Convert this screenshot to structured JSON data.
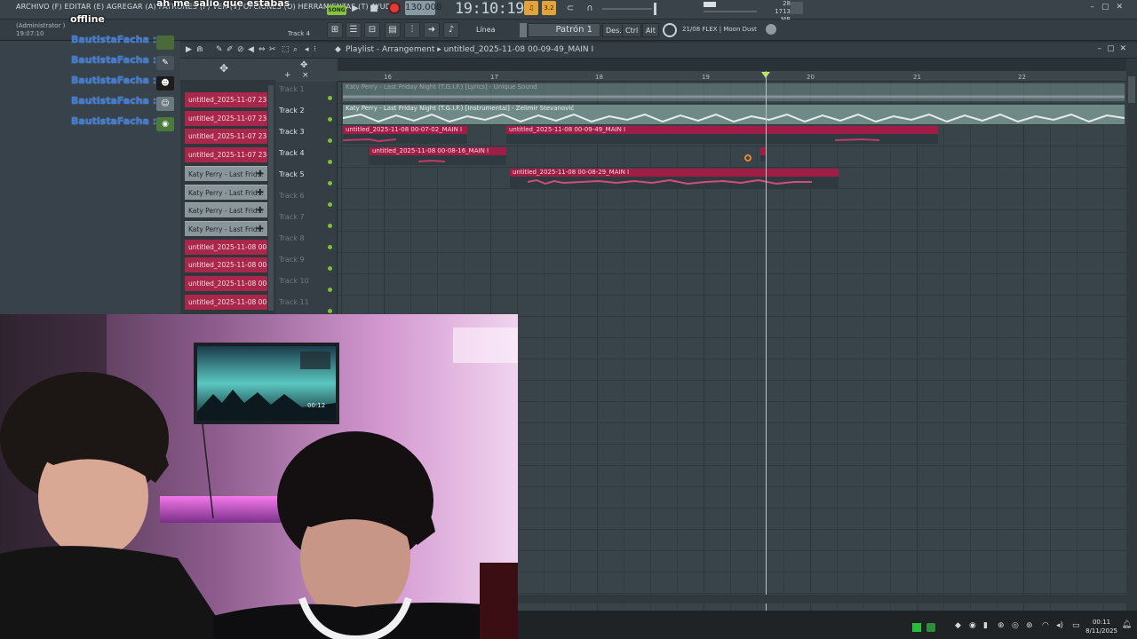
{
  "menu": {
    "text": "ARCHIVO (F) EDITAR (E) AGREGAR (A) PATRONES (P) VER (V) OPCIONES (O) HERRAMIENTAS (T) AYUDA"
  },
  "overlay_chat": {
    "line1": "ah me salio que estabas",
    "line2": "offline"
  },
  "transport": {
    "song_label": "SONG",
    "tempo": "130.000",
    "time": "19:10:19",
    "cpu_lines": [
      "28",
      "1713 MB",
      "0"
    ]
  },
  "toolbar2": {
    "admin_line1": "(Administrator )",
    "admin_line2": "19:07:10",
    "track_hint": "Track 4",
    "snap": "Línea",
    "pattern": "Patrón 1",
    "btn_des": "Des.",
    "btn_ctrl": "Ctrl",
    "btn_alt": "Alt",
    "flex_info": "21/08  FLEX | Moon Dust"
  },
  "chat": {
    "user": "BautistaFacha :",
    "messages": [
      "",
      "",
      "",
      "",
      ""
    ]
  },
  "playlist": {
    "title": "Playlist - Arrangement  ▸  untitled_2025-11-08 00-09-49_MAIN I"
  },
  "picker": {
    "items": [
      {
        "label": "untitled_2025-11-07 23-...",
        "type": "red"
      },
      {
        "label": "untitled_2025-11-07 23-...",
        "type": "red"
      },
      {
        "label": "untitled_2025-11-07 23-...",
        "type": "red"
      },
      {
        "label": "untitled_2025-11-07 23-...",
        "type": "red"
      },
      {
        "label": "Katy Perry - Last Frid...",
        "type": "gray"
      },
      {
        "label": "Katy Perry - Last Frid...",
        "type": "gray"
      },
      {
        "label": "Katy Perry - Last Frid...",
        "type": "gray"
      },
      {
        "label": "Katy Perry - Last Frid...",
        "type": "gray"
      },
      {
        "label": "untitled_2025-11-08 00-...",
        "type": "red"
      },
      {
        "label": "untitled_2025-11-08 00-...",
        "type": "red"
      },
      {
        "label": "untitled_2025-11-08 00-...",
        "type": "red"
      },
      {
        "label": "untitled_2025-11-08 00-...",
        "type": "red"
      }
    ]
  },
  "tracks": [
    "Track 1",
    "Track 2",
    "Track 3",
    "Track 4",
    "Track 5",
    "Track 6",
    "Track 7",
    "Track 8",
    "Track 9",
    "Track 10",
    "Track 11"
  ],
  "timeline": {
    "bars": [
      "16",
      "17",
      "18",
      "19",
      "20",
      "21",
      "22"
    ]
  },
  "clips": {
    "track1": "Katy Perry - Last Friday Night (T.G.I.F.) [Lyrics] - Unique Sound",
    "track2": "Katy Perry - Last Friday Night (T.G.I.F.) [Instrumental] - Zelimir Stevanović",
    "track3a": "untitled_2025-11-08 00-07-02_MAIN I",
    "track3b": "untitled_2025-11-08 00-09-49_MAIN I",
    "track4": "untitled_2025-11-08 00-08-16_MAIN I",
    "track5": "untitled_2025-11-08 00-08-29_MAIN I"
  },
  "webcam": {
    "tv_time": "00:12"
  },
  "taskbar": {
    "time": "00:11",
    "date": "8/11/2025"
  },
  "colors": {
    "pattern_clip": "#a01e45",
    "audio_clip": "#6f8a86",
    "playlist_bg": "#38434a",
    "chat_user": "#3a7ad8"
  }
}
